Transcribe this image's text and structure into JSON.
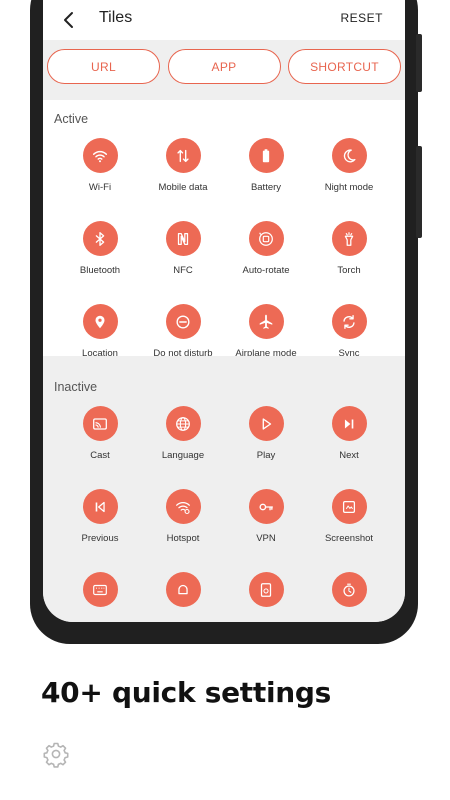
{
  "appbar": {
    "title": "Tiles",
    "reset_label": "RESET"
  },
  "tabs": [
    {
      "label": "URL"
    },
    {
      "label": "APP"
    },
    {
      "label": "SHORTCUT"
    }
  ],
  "active": {
    "title": "Active",
    "tiles": [
      {
        "label": "Wi-Fi",
        "icon": "wifi-icon"
      },
      {
        "label": "Mobile data",
        "icon": "mobile-data-icon"
      },
      {
        "label": "Battery",
        "icon": "battery-icon"
      },
      {
        "label": "Night mode",
        "icon": "moon-icon"
      },
      {
        "label": "Bluetooth",
        "icon": "bluetooth-icon"
      },
      {
        "label": "NFC",
        "icon": "nfc-icon"
      },
      {
        "label": "Auto-rotate",
        "icon": "auto-rotate-icon"
      },
      {
        "label": "Torch",
        "icon": "torch-icon"
      },
      {
        "label": "Location",
        "icon": "location-pin-icon"
      },
      {
        "label": "Do not disturb",
        "icon": "do-not-disturb-icon"
      },
      {
        "label": "Airplane mode",
        "icon": "airplane-icon"
      },
      {
        "label": "Sync",
        "icon": "sync-icon"
      }
    ]
  },
  "inactive": {
    "title": "Inactive",
    "tiles": [
      {
        "label": "Cast",
        "icon": "cast-icon"
      },
      {
        "label": "Language",
        "icon": "globe-icon"
      },
      {
        "label": "Play",
        "icon": "play-icon"
      },
      {
        "label": "Next",
        "icon": "skip-next-icon"
      },
      {
        "label": "Previous",
        "icon": "skip-previous-icon"
      },
      {
        "label": "Hotspot",
        "icon": "hotspot-icon"
      },
      {
        "label": "VPN",
        "icon": "vpn-key-icon"
      },
      {
        "label": "Screenshot",
        "icon": "screenshot-icon"
      },
      {
        "label": "",
        "icon": "keyboard-icon"
      },
      {
        "label": "",
        "icon": "bell-icon"
      },
      {
        "label": "",
        "icon": "timer-screen-icon"
      },
      {
        "label": "",
        "icon": "stopwatch-icon"
      }
    ]
  },
  "footer": {
    "headline": "40+ quick settings",
    "icon": "gear-icon"
  },
  "colors": {
    "accent": "#ed6a55",
    "frame": "#202020",
    "screen_bg": "#efefef"
  }
}
